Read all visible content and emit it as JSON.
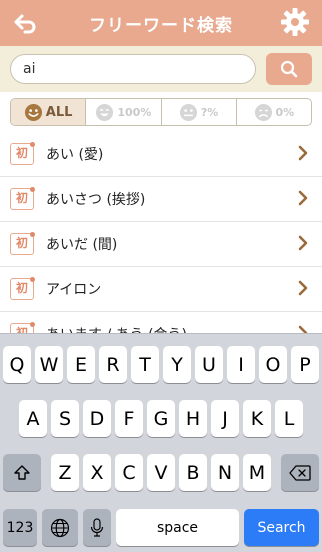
{
  "header": {
    "title": "フリーワード検索",
    "back_icon": "back-arrow-icon",
    "settings_icon": "gear-icon",
    "bg_color": "#e8a98f"
  },
  "search": {
    "value": "ai",
    "button_icon": "search-icon"
  },
  "filters": [
    {
      "label": "ALL",
      "icon": "smile-face-icon",
      "active": true
    },
    {
      "label": "100%",
      "icon": "laugh-face-icon",
      "active": false
    },
    {
      "label": "?%",
      "icon": "neutral-face-icon",
      "active": false
    },
    {
      "label": "0%",
      "icon": "sad-face-icon",
      "active": false
    }
  ],
  "list": {
    "badge": "初",
    "items": [
      "あい (愛)",
      "あいさつ (挨拶)",
      "あいだ (間)",
      "アイロン",
      "あいます / あう (会う)"
    ]
  },
  "keyboard": {
    "row1": [
      "Q",
      "W",
      "E",
      "R",
      "T",
      "Y",
      "U",
      "I",
      "O",
      "P"
    ],
    "row2": [
      "A",
      "S",
      "D",
      "F",
      "G",
      "H",
      "J",
      "K",
      "L"
    ],
    "row3": [
      "Z",
      "X",
      "C",
      "V",
      "B",
      "N",
      "M"
    ],
    "numbers_label": "123",
    "space_label": "space",
    "search_label": "Search"
  }
}
